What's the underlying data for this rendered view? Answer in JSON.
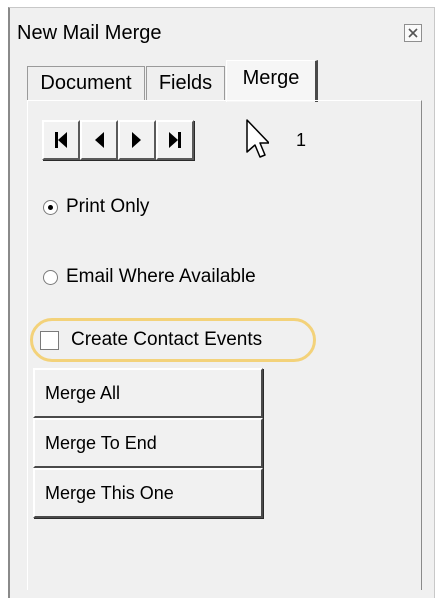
{
  "window": {
    "title": "New Mail Merge",
    "close_icon": "close-icon"
  },
  "tabs": [
    {
      "label": "Document"
    },
    {
      "label": "Fields"
    },
    {
      "label": "Merge",
      "active": true
    }
  ],
  "record_nav": {
    "icons": [
      "first-record-icon",
      "previous-record-icon",
      "next-record-icon",
      "last-record-icon"
    ],
    "current_record": "1"
  },
  "output_options": [
    {
      "label": "Print Only",
      "selected": true
    },
    {
      "label": "Email Where Available",
      "selected": false
    }
  ],
  "contact_events": {
    "label": "Create Contact Events",
    "checked": false,
    "highlight_color": "#f3d27a"
  },
  "merge_buttons": [
    {
      "label": "Merge All"
    },
    {
      "label": "Merge To End"
    },
    {
      "label": "Merge This One"
    }
  ]
}
